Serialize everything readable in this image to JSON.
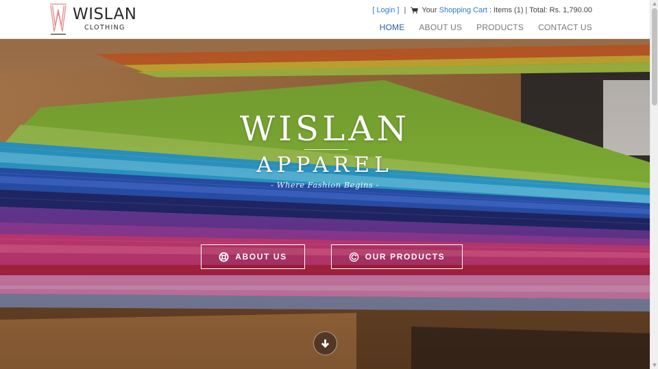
{
  "brand": {
    "logo_name": "WISLAN",
    "logo_sub": "CLOTHING",
    "accent_pink": "#e08b8b"
  },
  "topbar": {
    "login": "[ Login ]",
    "separator": "|",
    "cart_prefix": "Your",
    "cart_link": "Shopping Cart",
    "cart_summary": ": Items (1) | Total: Rs. 1,790.00"
  },
  "nav": {
    "items": [
      {
        "label": "HOME",
        "active": true
      },
      {
        "label": "ABOUT US",
        "active": false
      },
      {
        "label": "PRODUCTS",
        "active": false
      },
      {
        "label": "CONTACT US",
        "active": false
      }
    ]
  },
  "hero": {
    "title": "WISLAN",
    "subtitle": "APPAREL",
    "tagline": "- Where Fashion Begins -",
    "buttons": {
      "about": {
        "label": "ABOUT US",
        "icon": "lifebuoy-icon"
      },
      "products": {
        "label": "OUR PRODUCTS",
        "icon": "refresh-icon"
      }
    },
    "scroll_icon": "arrow-down-icon"
  },
  "colors": {
    "link": "#2a7bd1",
    "nav_active": "#1e5fa8",
    "nav_text": "#777777"
  }
}
